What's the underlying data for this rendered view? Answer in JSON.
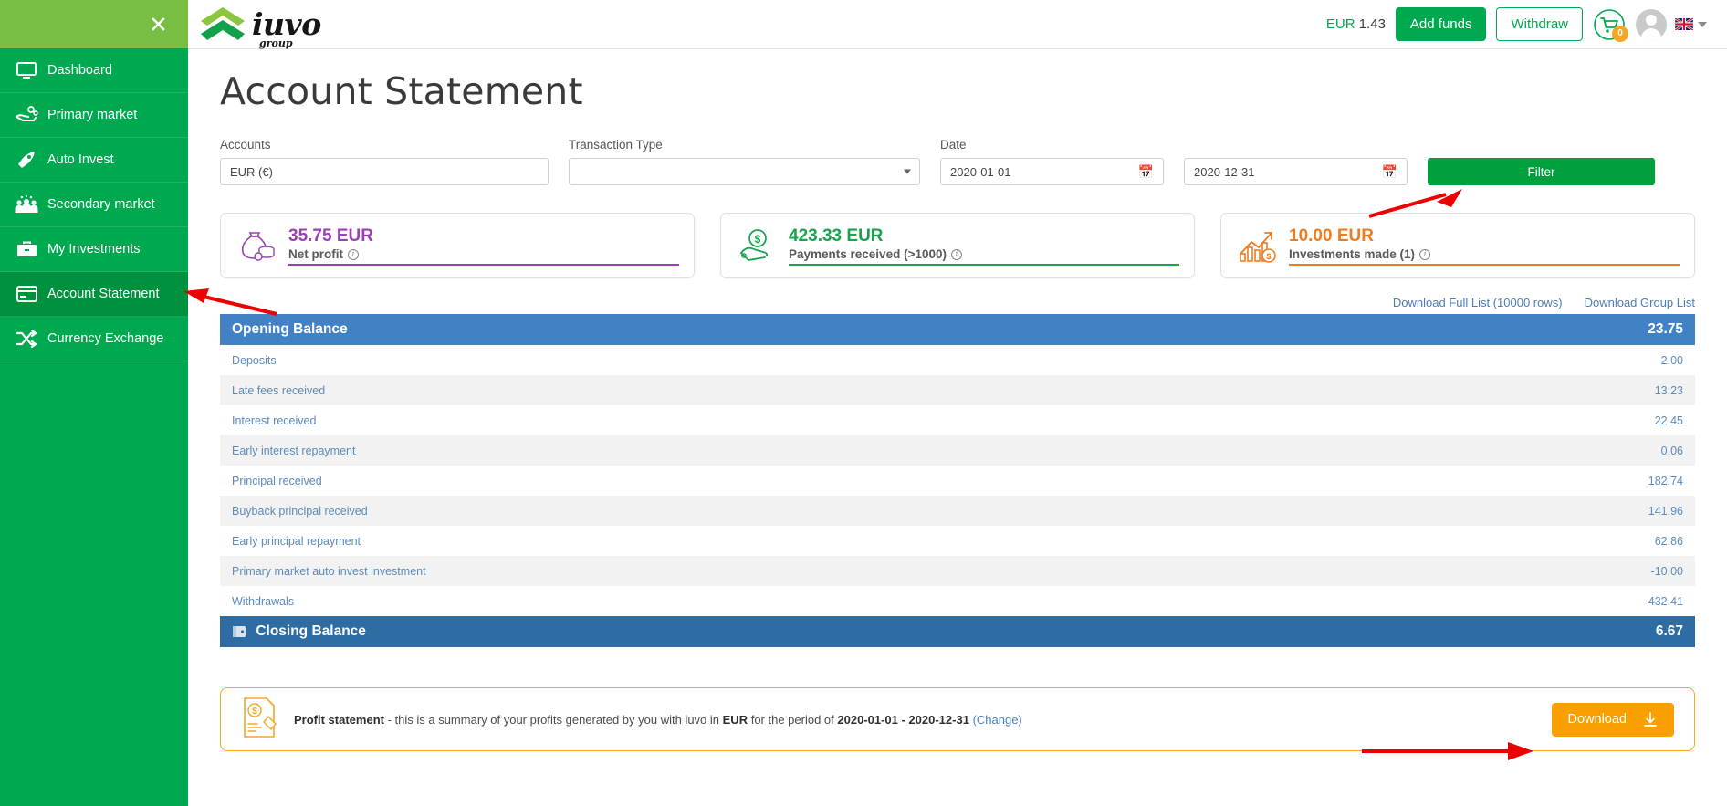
{
  "sidebar": {
    "close_label": "✕",
    "items": [
      {
        "label": "Dashboard",
        "icon": "monitor-icon",
        "active": false
      },
      {
        "label": "Primary market",
        "icon": "hand-coins-icon",
        "active": false
      },
      {
        "label": "Auto Invest",
        "icon": "rocket-icon",
        "active": false
      },
      {
        "label": "Secondary market",
        "icon": "people-icon",
        "active": false
      },
      {
        "label": "My Investments",
        "icon": "briefcase-icon",
        "active": false
      },
      {
        "label": "Account Statement",
        "icon": "card-icon",
        "active": true
      },
      {
        "label": "Currency Exchange",
        "icon": "shuffle-icon",
        "active": false
      }
    ]
  },
  "header": {
    "logo_main": "iuvo",
    "logo_sub": "group",
    "balance_currency": "EUR",
    "balance_amount": "1.43",
    "add_funds_label": "Add funds",
    "withdraw_label": "Withdraw",
    "cart_count": "0",
    "language": "en-GB"
  },
  "page": {
    "title": "Account Statement"
  },
  "filters": {
    "accounts_label": "Accounts",
    "accounts_value": "EUR (€)",
    "transaction_type_label": "Transaction Type",
    "transaction_type_value": "",
    "date_label": "Date",
    "date_from": "2020-01-01",
    "date_to": "2020-12-31",
    "filter_button": "Filter"
  },
  "cards": [
    {
      "amount": "35.75 EUR",
      "label": "Net profit",
      "color": "#9b3fb5",
      "icon": "money-bag-icon"
    },
    {
      "amount": "423.33 EUR",
      "label": "Payments received (>1000)",
      "color": "#17a44b",
      "icon": "hand-dollar-icon"
    },
    {
      "amount": "10.00 EUR",
      "label": "Investments made (1)",
      "color": "#f07c20",
      "icon": "growth-chart-icon"
    }
  ],
  "downloads": {
    "full_list": "Download Full List (10000 rows)",
    "group_list": "Download Group List"
  },
  "statement": {
    "opening_label": "Opening Balance",
    "opening_value": "23.75",
    "closing_label": "Closing Balance",
    "closing_value": "6.67",
    "rows": [
      {
        "label": "Deposits",
        "value": "2.00",
        "sign": "pos"
      },
      {
        "label": "Late fees received",
        "value": "13.23",
        "sign": "pos"
      },
      {
        "label": "Interest received",
        "value": "22.45",
        "sign": "pos"
      },
      {
        "label": "Early interest repayment",
        "value": "0.06",
        "sign": "pos"
      },
      {
        "label": "Principal received",
        "value": "182.74",
        "sign": "pos"
      },
      {
        "label": "Buyback principal received",
        "value": "141.96",
        "sign": "pos"
      },
      {
        "label": "Early principal repayment",
        "value": "62.86",
        "sign": "pos"
      },
      {
        "label": "Primary market auto invest investment",
        "value": "-10.00",
        "sign": "neg"
      },
      {
        "label": "Withdrawals",
        "value": "-432.41",
        "sign": "neg"
      }
    ]
  },
  "profit_statement": {
    "title": "Profit statement",
    "text_1": " - this is a summary of your profits generated by you with iuvo in ",
    "currency": "EUR",
    "text_2": " for the period of ",
    "period": "2020-01-01 - 2020-12-31",
    "change_label": "(Change)",
    "download_label": "Download"
  }
}
